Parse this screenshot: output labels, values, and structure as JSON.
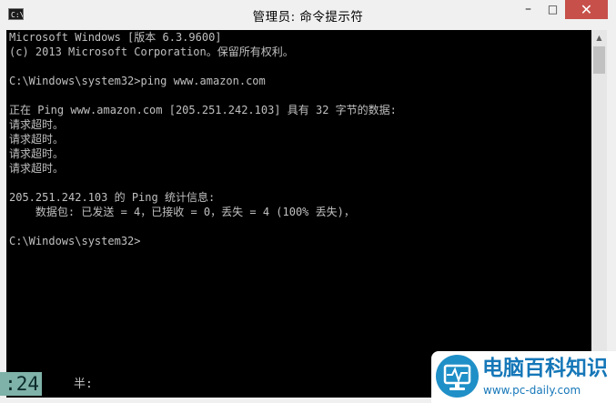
{
  "window": {
    "title": "管理员: 命令提示符",
    "icon_label": "C:\\",
    "icon_name": "cmd-icon",
    "buttons": {
      "minimize": "–",
      "maximize": "□",
      "close": "✕"
    },
    "close_button_color": "#c7504a"
  },
  "console": {
    "background_color": "#000000",
    "text_color": "#c0c0c0",
    "lines": [
      "Microsoft Windows [版本 6.3.9600]",
      "(c) 2013 Microsoft Corporation。保留所有权利。",
      "",
      "C:\\Windows\\system32>ping www.amazon.com",
      "",
      "正在 Ping www.amazon.com [205.251.242.103] 具有 32 字节的数据:",
      "请求超时。",
      "请求超时。",
      "请求超时。",
      "请求超时。",
      "",
      "205.251.242.103 的 Ping 统计信息:",
      "    数据包: 已发送 = 4，已接收 = 0，丢失 = 4 (100% 丢失)，",
      "",
      "C:\\Windows\\system32>"
    ]
  },
  "scrollbar": {
    "up_arrow": "▲",
    "down_arrow": "▼"
  },
  "status": {
    "clock": ":24",
    "ime_mode": "半:"
  },
  "watermark": {
    "name": "电脑百科知识",
    "url": "www.pc-daily.com",
    "logo_icon": "monitor-pulse-icon",
    "brand_color": "#1577b8"
  }
}
